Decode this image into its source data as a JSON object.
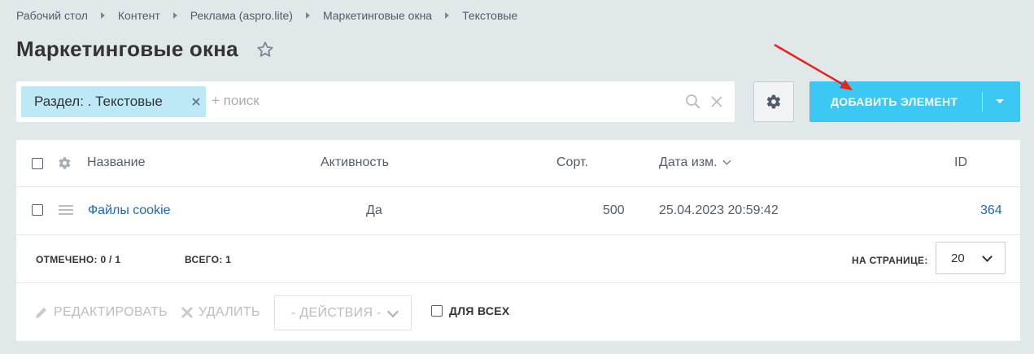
{
  "breadcrumb": {
    "items": [
      "Рабочий стол",
      "Контент",
      "Реклама (aspro.lite)",
      "Маркетинговые окна",
      "Текстовые"
    ]
  },
  "page": {
    "title": "Маркетинговые окна"
  },
  "filter": {
    "chip_label": "Раздел: . Текстовые",
    "search_placeholder": "+ поиск"
  },
  "toolbar": {
    "add_label": "ДОБАВИТЬ ЭЛЕМЕНТ"
  },
  "table": {
    "headers": {
      "name": "Название",
      "active": "Активность",
      "sort": "Сорт.",
      "date": "Дата изм.",
      "id": "ID"
    },
    "rows": [
      {
        "name": "Файлы cookie",
        "active": "Да",
        "sort": "500",
        "date": "25.04.2023 20:59:42",
        "id": "364"
      }
    ]
  },
  "footer": {
    "checked_label": "ОТМЕЧЕНО:",
    "checked_value": "0 / 1",
    "total_label": "ВСЕГО:",
    "total_value": "1",
    "per_page_label": "НА СТРАНИЦЕ:",
    "per_page_value": "20"
  },
  "actions": {
    "edit": "РЕДАКТИРОВАТЬ",
    "delete": "УДАЛИТЬ",
    "select": "- ДЕЙСТВИЯ -",
    "for_all": "ДЛЯ ВСЕХ"
  },
  "colors": {
    "accent": "#3bc8f5",
    "link": "#2067b0",
    "background": "#e0e8ea",
    "annotation_arrow": "#e8231c"
  }
}
